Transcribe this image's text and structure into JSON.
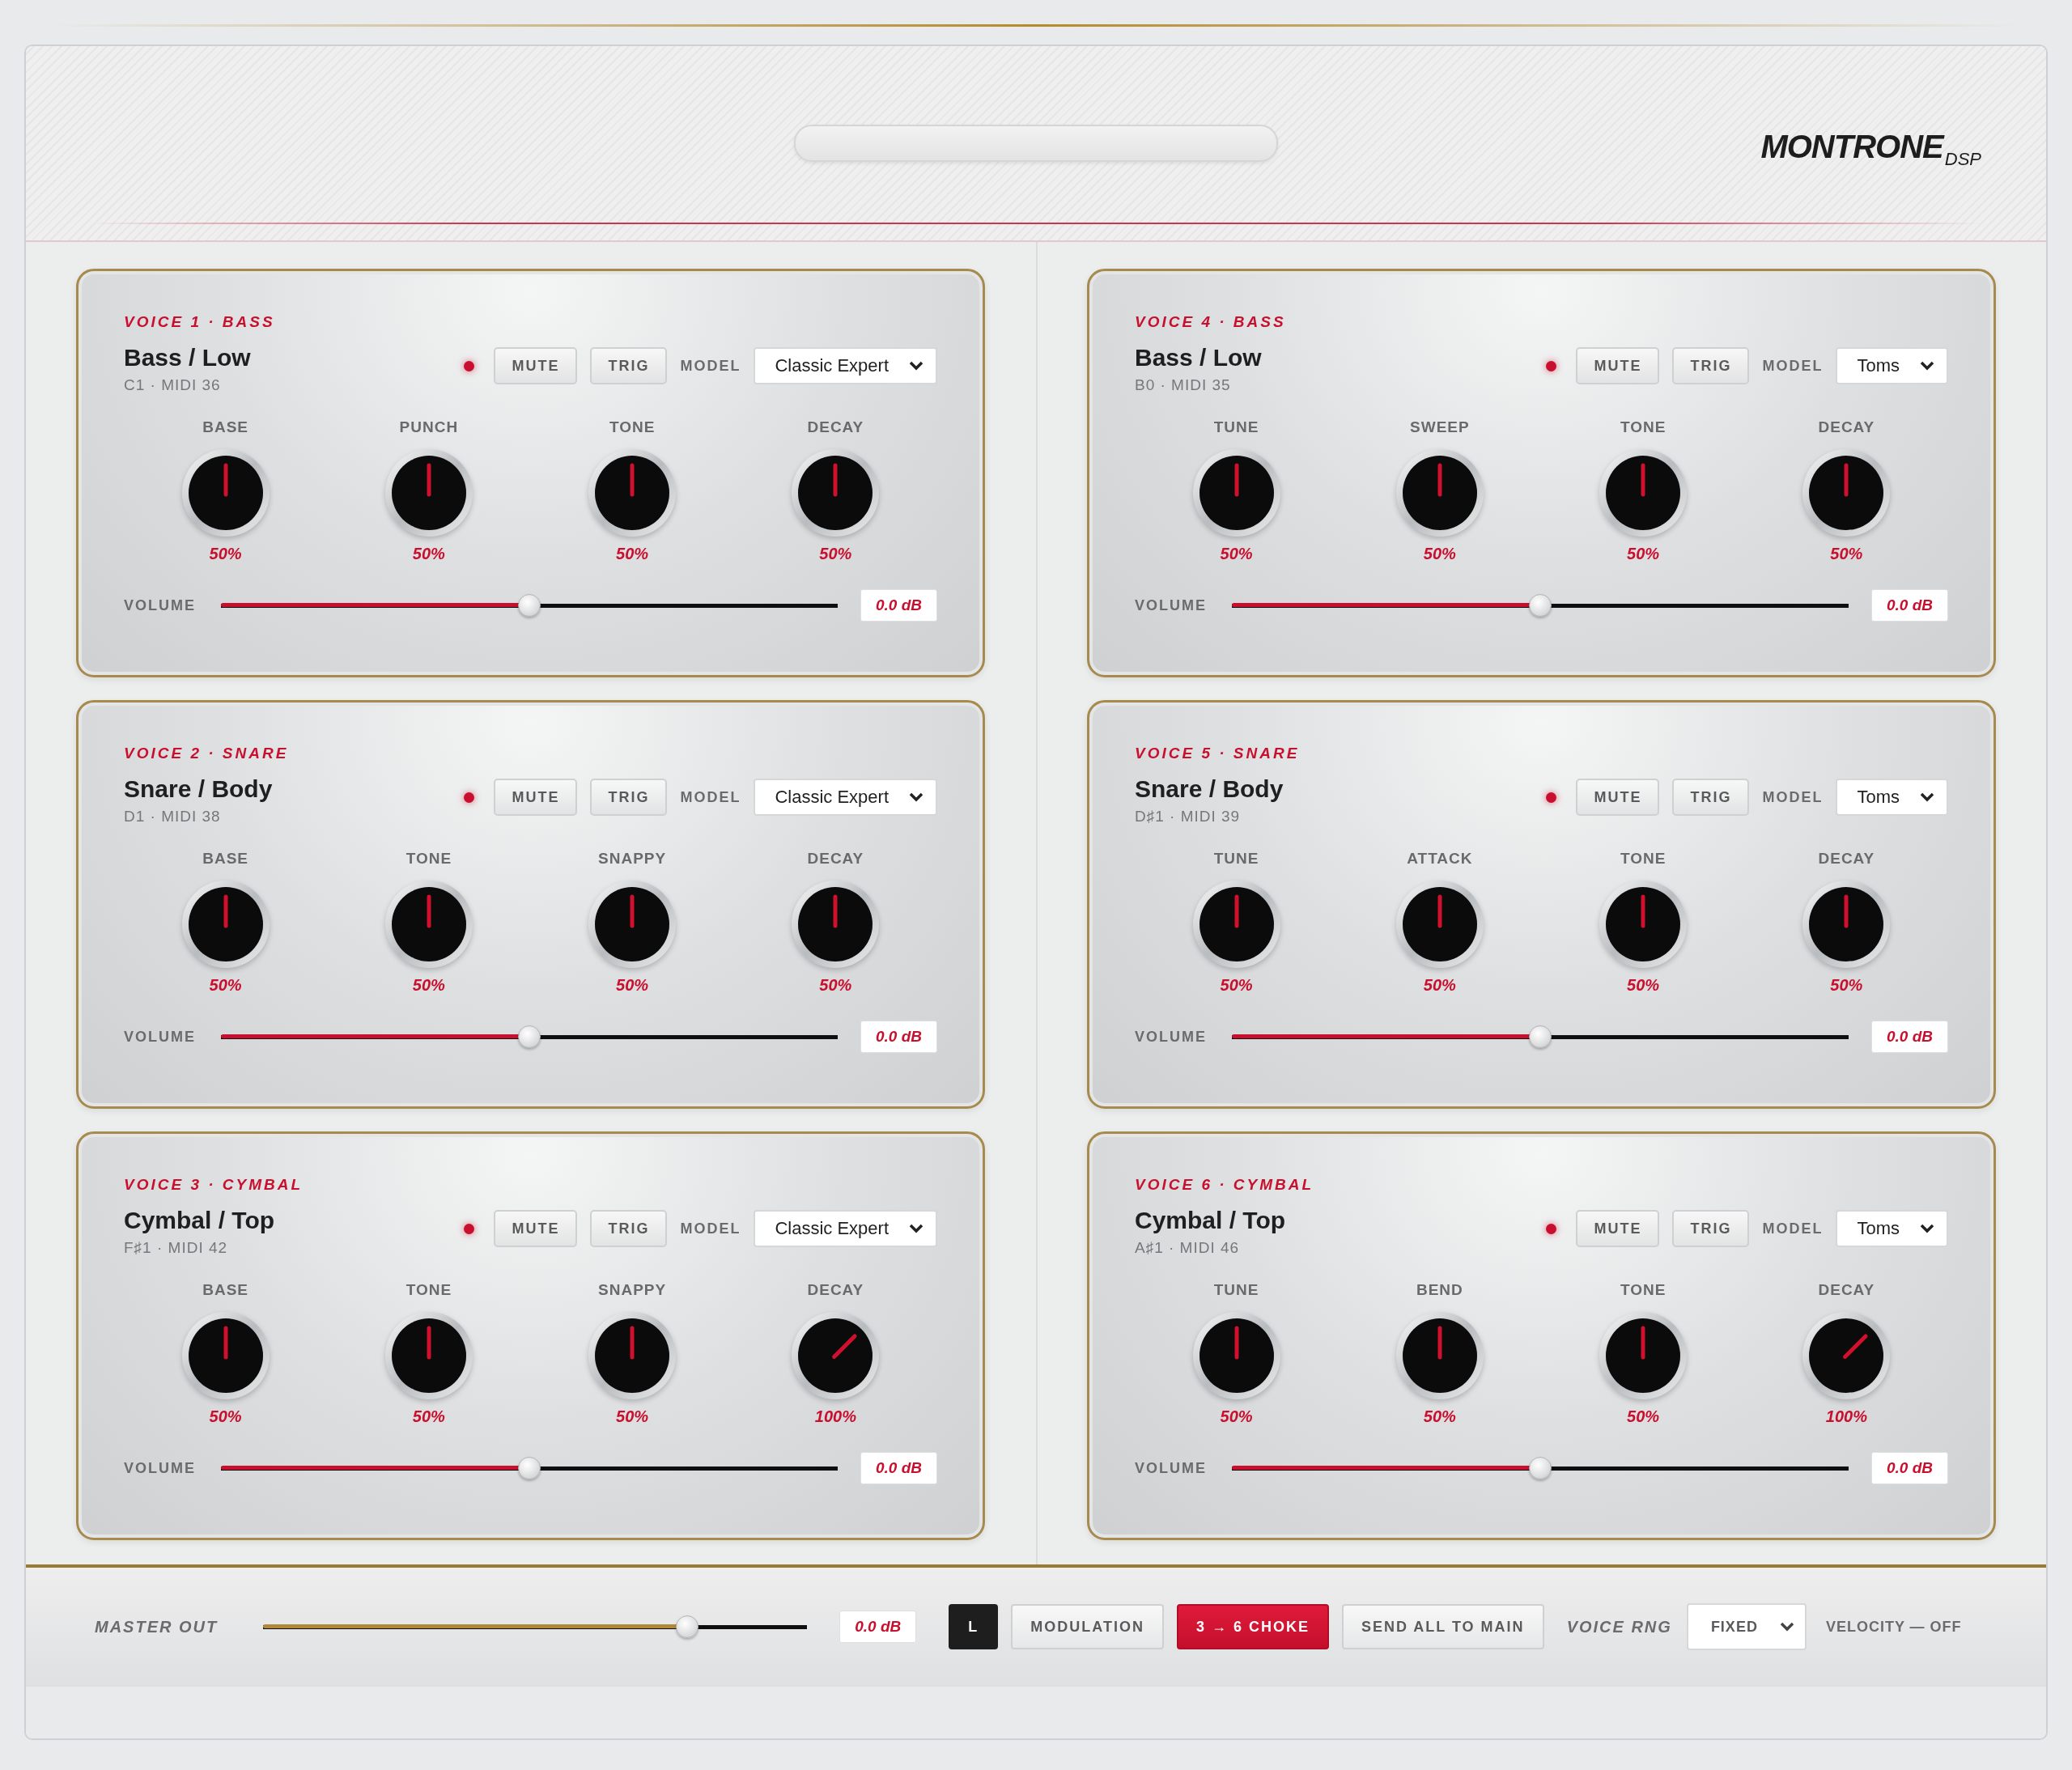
{
  "header": {
    "brand": "MONTRONE",
    "brand_suffix": "DSP"
  },
  "voices": [
    {
      "tag": "VOICE 1 · BASS",
      "name": "Bass / Low",
      "note": "C1 · MIDI 36",
      "active": true,
      "mute": "MUTE",
      "trig": "TRIG",
      "model_label": "MODEL",
      "model": "Classic Expert",
      "knobs": [
        {
          "label": "BASE",
          "value": "50%"
        },
        {
          "label": "PUNCH",
          "value": "50%"
        },
        {
          "label": "TONE",
          "value": "50%"
        },
        {
          "label": "DECAY",
          "value": "50%"
        }
      ],
      "volume_label": "VOLUME",
      "volume": {
        "level": 0.5,
        "reading": "0.0 dB"
      }
    },
    {
      "tag": "VOICE 4 · BASS",
      "name": "Bass / Low",
      "note": "B0 · MIDI 35",
      "active": true,
      "mute": "MUTE",
      "trig": "TRIG",
      "model_label": "MODEL",
      "model": "Toms",
      "knobs": [
        {
          "label": "TUNE",
          "value": "50%"
        },
        {
          "label": "SWEEP",
          "value": "50%"
        },
        {
          "label": "TONE",
          "value": "50%"
        },
        {
          "label": "DECAY",
          "value": "50%"
        }
      ],
      "volume_label": "VOLUME",
      "volume": {
        "level": 0.5,
        "reading": "0.0 dB"
      }
    },
    {
      "tag": "VOICE 2 · SNARE",
      "name": "Snare / Body",
      "note": "D1 · MIDI 38",
      "active": true,
      "mute": "MUTE",
      "trig": "TRIG",
      "model_label": "MODEL",
      "model": "Classic Expert",
      "knobs": [
        {
          "label": "BASE",
          "value": "50%"
        },
        {
          "label": "TONE",
          "value": "50%"
        },
        {
          "label": "SNAPPY",
          "value": "50%"
        },
        {
          "label": "DECAY",
          "value": "50%"
        }
      ],
      "volume_label": "VOLUME",
      "volume": {
        "level": 0.5,
        "reading": "0.0 dB"
      }
    },
    {
      "tag": "VOICE 5 · SNARE",
      "name": "Snare / Body",
      "note": "D♯1 · MIDI 39",
      "active": true,
      "mute": "MUTE",
      "trig": "TRIG",
      "model_label": "MODEL",
      "model": "Toms",
      "knobs": [
        {
          "label": "TUNE",
          "value": "50%"
        },
        {
          "label": "ATTACK",
          "value": "50%"
        },
        {
          "label": "TONE",
          "value": "50%"
        },
        {
          "label": "DECAY",
          "value": "50%"
        }
      ],
      "volume_label": "VOLUME",
      "volume": {
        "level": 0.5,
        "reading": "0.0 dB"
      }
    },
    {
      "tag": "VOICE 3 · CYMBAL",
      "name": "Cymbal / Top",
      "note": "F♯1 · MIDI 42",
      "active": true,
      "mute": "MUTE",
      "trig": "TRIG",
      "model_label": "MODEL",
      "model": "Classic Expert",
      "knobs": [
        {
          "label": "BASE",
          "value": "50%"
        },
        {
          "label": "TONE",
          "value": "50%"
        },
        {
          "label": "SNAPPY",
          "value": "50%"
        },
        {
          "label": "DECAY",
          "value": "100%"
        }
      ],
      "volume_label": "VOLUME",
      "volume": {
        "level": 0.5,
        "reading": "0.0 dB"
      }
    },
    {
      "tag": "VOICE 6 · CYMBAL",
      "name": "Cymbal / Top",
      "note": "A♯1 · MIDI 46",
      "active": true,
      "mute": "MUTE",
      "trig": "TRIG",
      "model_label": "MODEL",
      "model": "Toms",
      "knobs": [
        {
          "label": "TUNE",
          "value": "50%"
        },
        {
          "label": "BEND",
          "value": "50%"
        },
        {
          "label": "TONE",
          "value": "50%"
        },
        {
          "label": "DECAY",
          "value": "100%"
        }
      ],
      "volume_label": "VOLUME",
      "volume": {
        "level": 0.5,
        "reading": "0.0 dB"
      }
    }
  ],
  "master": {
    "label": "MASTER OUT",
    "level": 0.78,
    "reading": "0.0 dB"
  },
  "buttons": [
    {
      "label": "L",
      "kind": "dark"
    },
    {
      "label": "MODULATION",
      "kind": "plain"
    },
    {
      "label": "3 → 6 CHOKE",
      "kind": "accent"
    },
    {
      "label": "SEND ALL TO MAIN",
      "kind": "plain"
    }
  ],
  "voice_rng": {
    "label": "VOICE RNG",
    "value": "FIXED"
  },
  "velocity": "VELOCITY — OFF"
}
